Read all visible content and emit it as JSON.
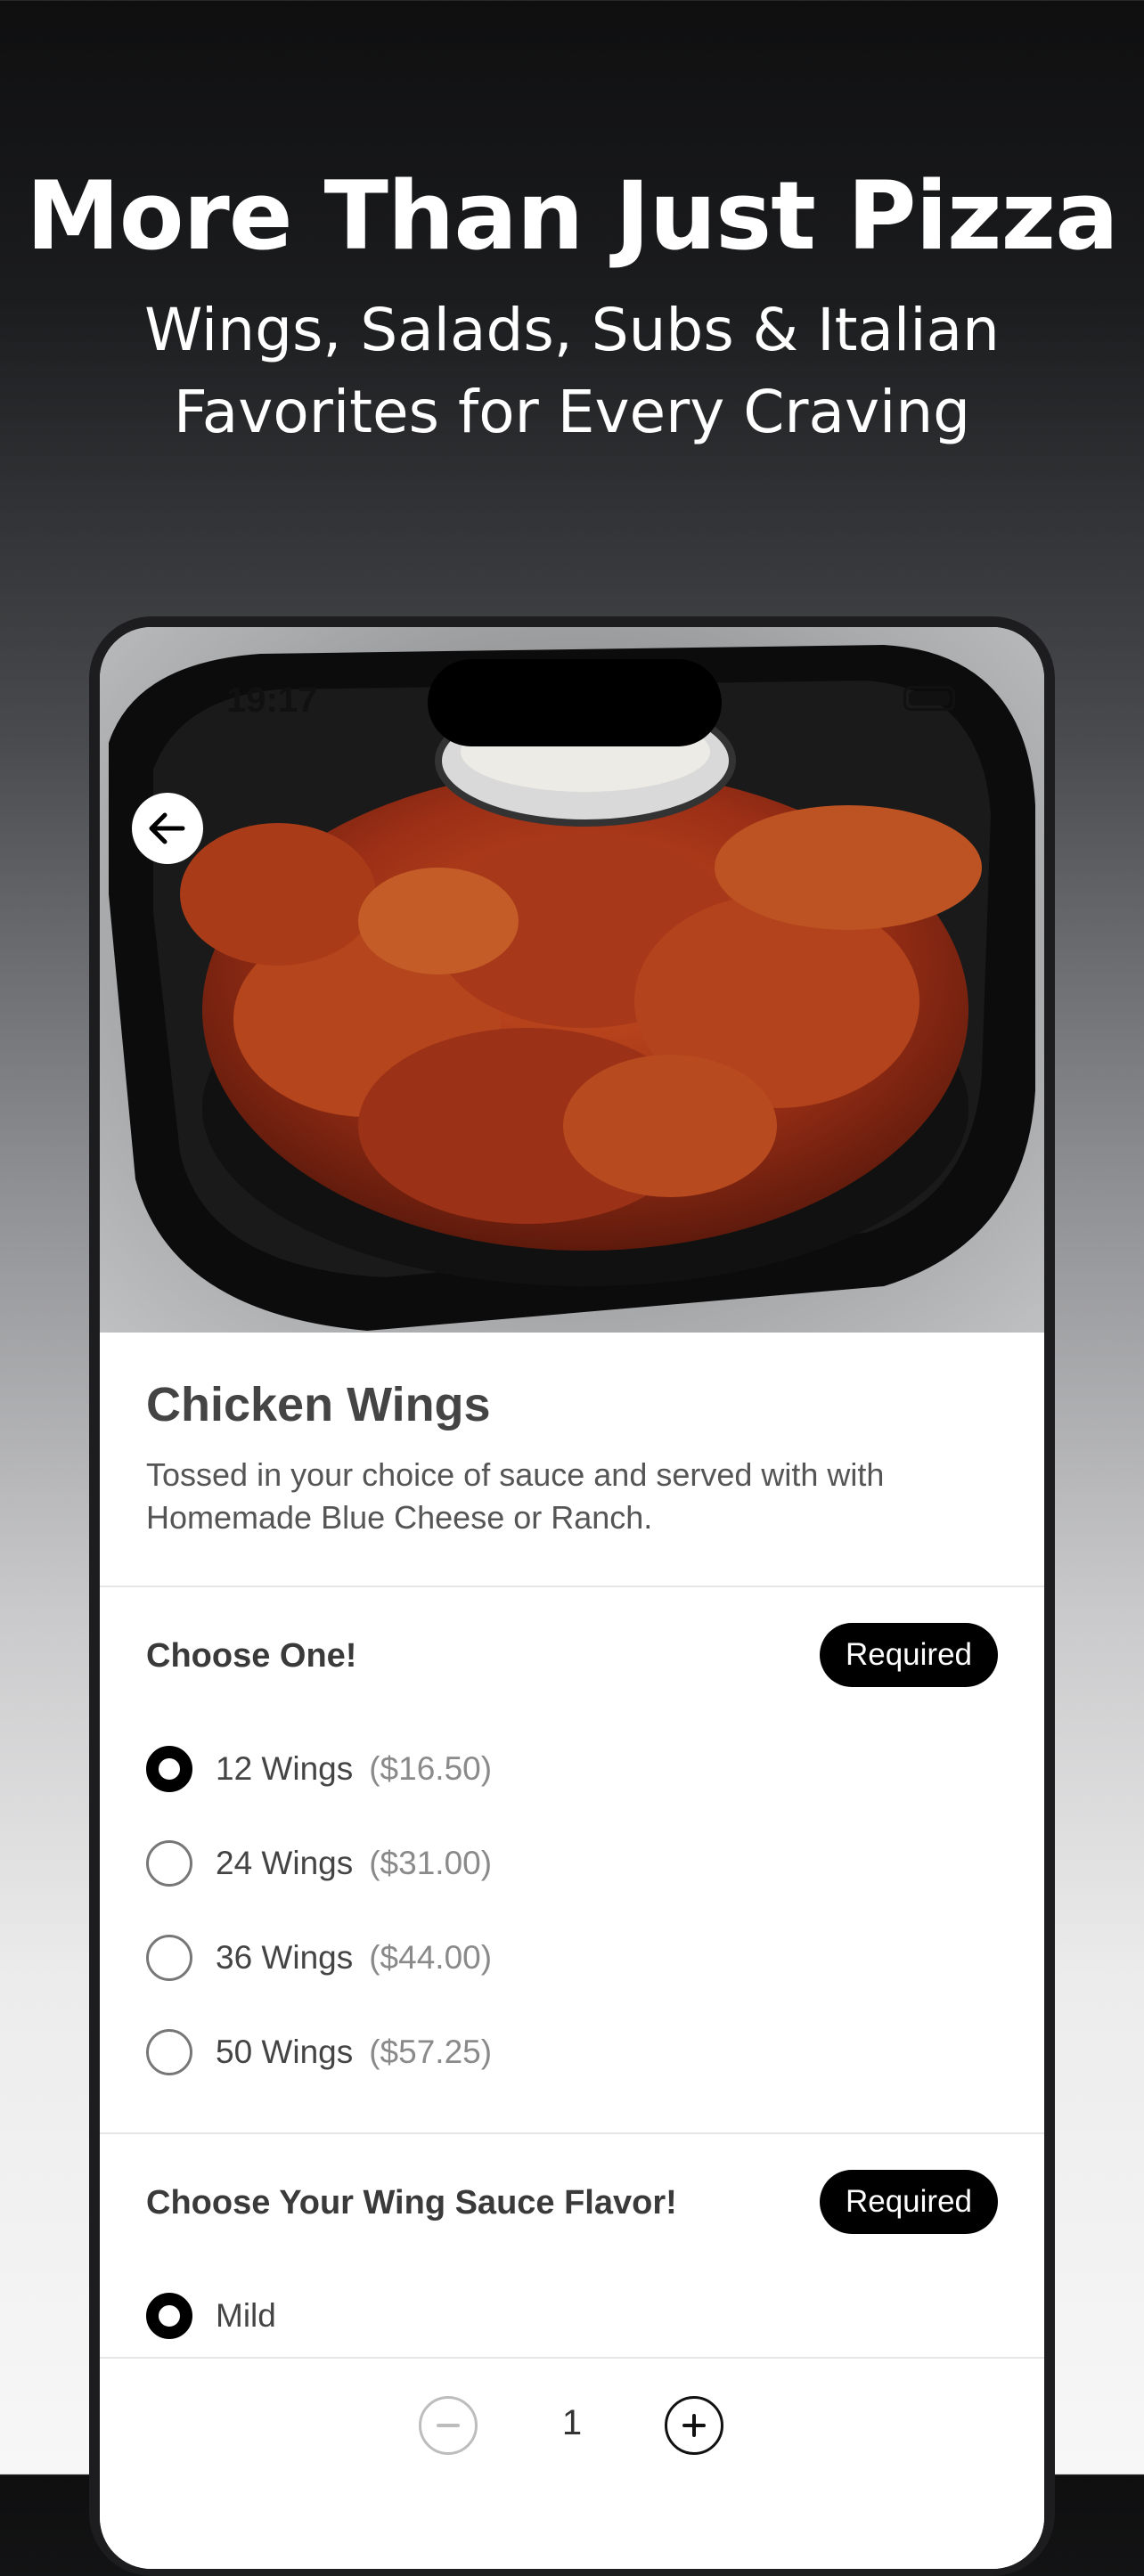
{
  "hero": {
    "title": "More Than Just Pizza",
    "subtitle_line1": "Wings, Salads, Subs & Italian",
    "subtitle_line2": "Favorites for Every Craving"
  },
  "status_bar": {
    "time": "19:17"
  },
  "item": {
    "title": "Chicken Wings",
    "description": "Tossed in your choice of sauce and served with with Homemade Blue Cheese or Ranch."
  },
  "sections": [
    {
      "title": "Choose One!",
      "badge": "Required",
      "options": [
        {
          "label": "12 Wings",
          "price": "($16.50)",
          "selected": true
        },
        {
          "label": "24 Wings",
          "price": "($31.00)",
          "selected": false
        },
        {
          "label": "36 Wings",
          "price": "($44.00)",
          "selected": false
        },
        {
          "label": "50 Wings",
          "price": "($57.25)",
          "selected": false
        }
      ]
    },
    {
      "title": "Choose Your Wing Sauce Flavor!",
      "badge": "Required",
      "options": [
        {
          "label": "Mild",
          "selected": true
        }
      ]
    }
  ],
  "quantity": {
    "value": "1"
  },
  "icons": {
    "back": "back-arrow-icon",
    "minus": "minus-icon",
    "plus": "plus-icon"
  },
  "colors": {
    "accent": "#000000",
    "sauce": "#a3361b"
  }
}
